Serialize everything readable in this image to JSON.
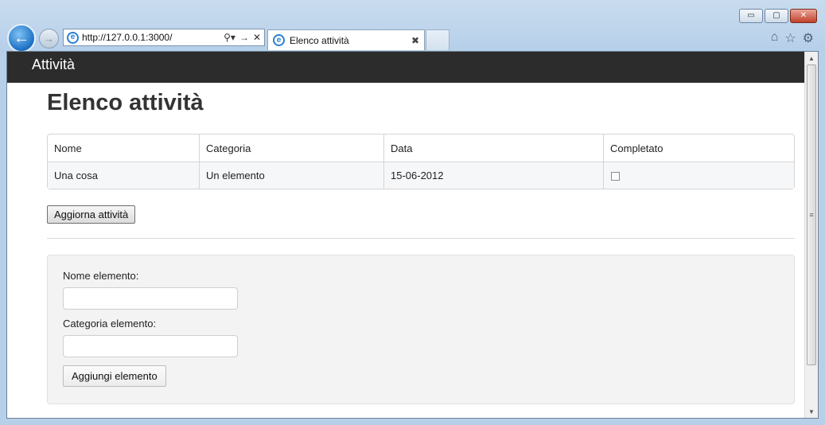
{
  "browser": {
    "address": "http://127.0.0.1:3000/",
    "tab_title": "Elenco attività",
    "window_buttons": {
      "minimize": "▭",
      "maximize": "▢",
      "close": "✕"
    }
  },
  "topbar": {
    "brand": "Attività"
  },
  "page": {
    "heading": "Elenco attività",
    "table": {
      "headers": [
        "Nome",
        "Categoria",
        "Data",
        "Completato"
      ],
      "rows": [
        {
          "nome": "Una cosa",
          "categoria": "Un elemento",
          "data": "15-06-2012",
          "completato": false
        }
      ]
    },
    "refresh_button": "Aggiorna attività",
    "form": {
      "name_label": "Nome elemento:",
      "name_value": "",
      "category_label": "Categoria elemento:",
      "category_value": "",
      "add_button": "Aggiungi elemento"
    }
  },
  "icons": [
    "back-icon",
    "forward-icon",
    "ie-icon",
    "search-icon",
    "go-icon",
    "stop-icon",
    "tab-close-icon",
    "home-icon",
    "favorites-icon",
    "tools-icon"
  ]
}
